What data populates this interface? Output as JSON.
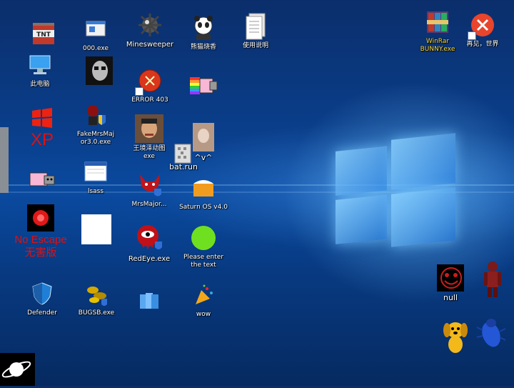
{
  "desktop": {
    "icons": {
      "tnt": "",
      "thispc": "此电脑",
      "xp_logo_text": "XP",
      "nyan_left": "",
      "noescape": "No Escape\n无害版",
      "defender": "Defender",
      "exe000": "000.exe",
      "skull": "",
      "fakemrs": "FakeMrsMaj\nor3.0.exe",
      "lsass": "lsass",
      "white": "",
      "bugs": "BUGSB.exe",
      "minesweeper": "Minesweeper",
      "error403": "ERROR 403",
      "wang": "王境泽动图\nexe",
      "mrsmajor": "MrsMajor...",
      "redeye": "RedEye.exe",
      "folder": "",
      "panda": "熊猫烧香",
      "nyan_mid": "",
      "batrun": "bat.run",
      "vface": "^v^",
      "saturn": "Saturn OS v4.0",
      "greencircle": "Please enter\nthe text",
      "wow": "wow",
      "docs": "使用说明",
      "winrar": "WinRar\nBUNNY.exe",
      "zaijian": "再见，世界",
      "null": "null",
      "rainbow": "",
      "dog": "",
      "bug": "",
      "planet": ""
    }
  }
}
